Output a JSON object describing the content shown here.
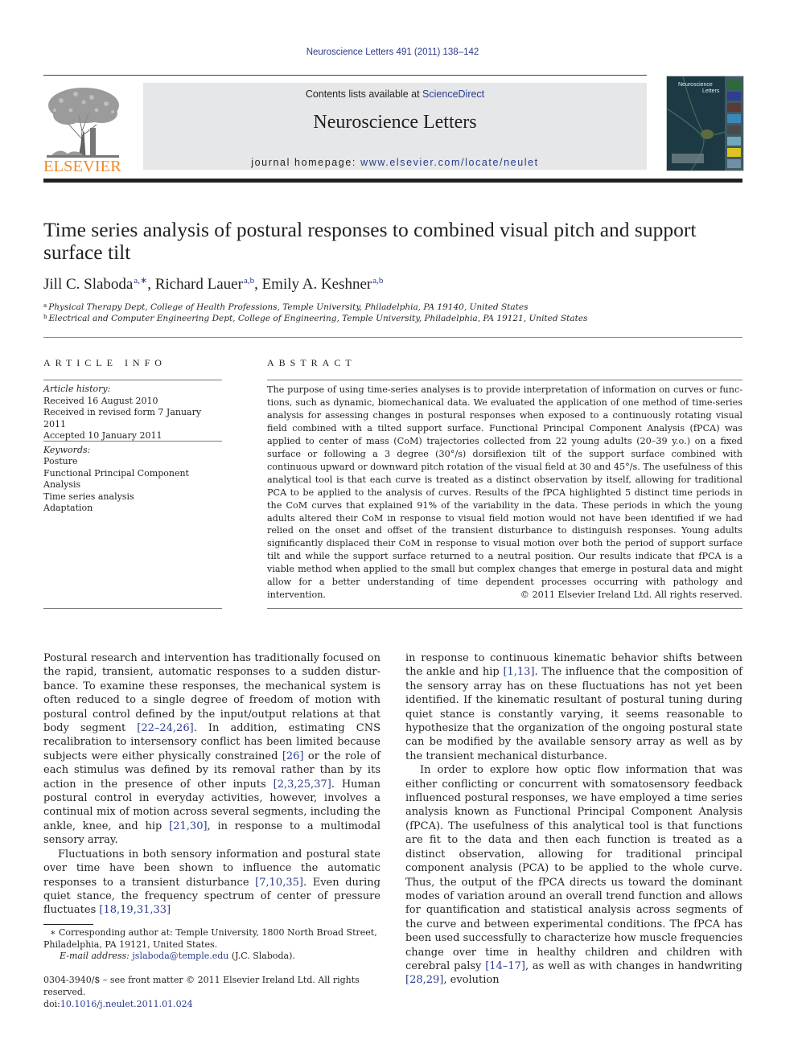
{
  "header": {
    "citation": "Neuroscience Letters 491 (2011) 138–142",
    "publisher_logo_text": "ELSEVIER",
    "contents_prefix": "Contents lists available at ",
    "contents_link": "ScienceDirect",
    "journal_name": "Neuroscience Letters",
    "homepage_prefix": "journal homepage: ",
    "homepage_link": "www.elsevier.com/locate/neulet",
    "cover_title_line1": "Neuroscience",
    "cover_title_line2": "Letters"
  },
  "article": {
    "title": "Time series analysis of postural responses to combined visual pitch and support surface tilt",
    "authors": [
      {
        "name": "Jill C. Slaboda",
        "sup": "a,∗"
      },
      {
        "name": "Richard Lauer",
        "sup": "a,b"
      },
      {
        "name": "Emily A. Keshner",
        "sup": "a,b"
      }
    ],
    "affiliations": [
      {
        "mark": "a",
        "text": "Physical Therapy Dept, College of Health Professions, Temple University, Philadelphia, PA 19140, United States"
      },
      {
        "mark": "b",
        "text": "Electrical and Computer Engineering Dept, College of Engineering, Temple University, Philadelphia, PA 19121, United States"
      }
    ]
  },
  "article_info": {
    "heading": "ARTICLE INFO",
    "history_label": "Article history:",
    "history": [
      "Received 16 August 2010",
      "Received in revised form 7 January 2011",
      "Accepted 10 January 2011"
    ],
    "keywords_label": "Keywords:",
    "keywords": [
      "Posture",
      "Functional Principal Component Analysis",
      "Time series analysis",
      "Adaptation"
    ]
  },
  "abstract": {
    "heading": "ABSTRACT",
    "text": "The purpose of using time-series analyses is to provide interpretation of information on curves or func­tions, such as dynamic, biomechanical data. We evaluated the application of one method of time-series analysis for assessing changes in postural responses when exposed to a continuously rotating visual field combined with a tilted support surface. Functional Principal Component Analysis (fPCA) was applied to center of mass (CoM) trajectories collected from 22 young adults (20–39 y.o.) on a fixed surface or following a 3 degree (30°/s) dorsiflexion tilt of the support surface combined with continuous upward or downward pitch rotation of the visual field at 30 and 45°/s. The usefulness of this analytical tool is that each curve is treated as a distinct observation by itself, allowing for traditional PCA to be applied to the analysis of curves. Results of the fPCA highlighted 5 distinct time periods in the CoM curves that explained 91% of the variability in the data. These periods in which the young adults altered their CoM in response to visual field motion would not have been identified if we had relied on the onset and off­set of the transient disturbance to distinguish responses. Young adults significantly displaced their CoM in response to visual motion over both the period of support surface tilt and while the support surface returned to a neutral position. Our results indicate that fPCA is a viable method when applied to the small but complex changes that emerge in postural data and might allow for a better understanding of time dependent processes occurring with pathology and intervention.",
    "copyright": "© 2011 Elsevier Ireland Ltd. All rights reserved."
  },
  "body": {
    "left": {
      "p1": [
        {
          "t": "Postural research and intervention has traditionally focused on the rapid, transient, automatic responses to a sudden distur­bance. To examine these responses, the mechanical system is often reduced to a single degree of freedom of motion with pos­tural control defined by the input/output relations at that body segment "
        },
        {
          "c": "[22–24,26]"
        },
        {
          "t": ". In addition, estimating CNS recalibration to intersensory conflict has been limited because subjects were either physically constrained "
        },
        {
          "c": "[26]"
        },
        {
          "t": " or the role of each stimulus was defined by its removal rather than by its action in the presence of other inputs "
        },
        {
          "c": "[2,3,25,37]"
        },
        {
          "t": ". Human postural control in everyday activities, however, involves a continual mix of motion across several seg­ments, including the ankle, knee, and hip "
        },
        {
          "c": "[21,30]"
        },
        {
          "t": ", in response to a multimodal sensory array."
        }
      ],
      "p2": [
        {
          "t": "Fluctuations in both sensory information and postural state over time have been shown to influence the automatic responses to a transient disturbance "
        },
        {
          "c": "[7,10,35]"
        },
        {
          "t": ". Even during quiet stance, the frequency spectrum of center of pressure fluctuates "
        },
        {
          "c": "[18,19,31,33]"
        }
      ]
    },
    "right": {
      "p1": [
        {
          "t": "in response to continuous kinematic behavior shifts between the ankle and hip "
        },
        {
          "c": "[1,13]"
        },
        {
          "t": ". The influence that the composition of the sen­sory array has on these fluctuations has not yet been identified. If the kinematic resultant of postural tuning during quiet stance is constantly varying, it seems reasonable to hypothesize that the organization of the ongoing postural state can be modified by the available sensory array as well as by the transient mechanical dis­turbance."
        }
      ],
      "p2": [
        {
          "t": "In order to explore how optic flow information that was either conflicting or concurrent with somatosensory feedback influenced postural responses, we have employed a time series analysis known as Functional Principal Component Analysis (fPCA). The usefulness of this analytical tool is that functions are fit to the data and then each function is treated as a distinct observation, allowing for tra­ditional principal component analysis (PCA) to be applied to the whole curve. Thus, the output of the fPCA directs us toward the dominant modes of variation around an overall trend function and allows for quantification and statistical analysis across segments of the curve and between experimental conditions. The fPCA has been used successfully to characterize how muscle frequencies change over time in healthy children and children with cerebral palsy "
        },
        {
          "c": "[14–17]"
        },
        {
          "t": ", as well as with changes in handwriting "
        },
        {
          "c": "[28,29]"
        },
        {
          "t": ", evolution"
        }
      ]
    }
  },
  "footnotes": {
    "corresponding": "∗ Corresponding author at: Temple University, 1800 North Broad Street, Philadel­phia, PA 19121, United States.",
    "email_label": "E-mail address:",
    "email": "jslaboda@temple.edu",
    "email_suffix": " (J.C. Slaboda).",
    "front_matter": "0304-3940/$ – see front matter © 2011 Elsevier Ireland Ltd. All rights reserved.",
    "doi_prefix": "doi:",
    "doi": "10.1016/j.neulet.2011.01.024"
  },
  "colors": {
    "link": "#2a3a8c",
    "elsevier_orange": "#f08a24",
    "banner_gray": "#e6e7e8",
    "text": "#231f20"
  }
}
